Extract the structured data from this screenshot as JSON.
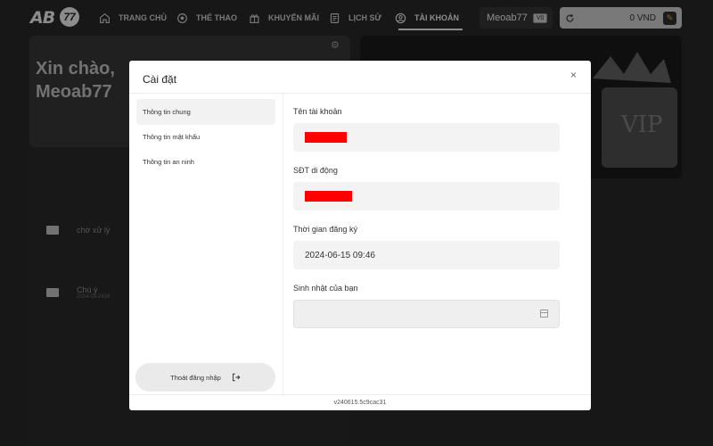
{
  "brand": {
    "logo_text": "AB",
    "logo_number": "77"
  },
  "nav": [
    {
      "id": "home",
      "label": "TRANG CHỦ",
      "icon": "home-icon"
    },
    {
      "id": "sports",
      "label": "THỂ THAO",
      "icon": "soccer-ball-icon"
    },
    {
      "id": "promo",
      "label": "KHUYẾN MÃI",
      "icon": "gift-icon"
    },
    {
      "id": "history",
      "label": "LỊCH SỬ",
      "icon": "document-icon"
    },
    {
      "id": "account",
      "label": "TÀI KHOẢN",
      "icon": "user-circle-icon",
      "active": true
    }
  ],
  "header": {
    "username": "Meoab77",
    "vip_badge": "V0",
    "balance": "0 VND"
  },
  "background": {
    "greeting_line1": "Xin chào,",
    "greeting_line2": "Meoab77",
    "notice_title": "Chú ý",
    "notice_date": "2024-03-2416",
    "status_text": "chờ xử lý"
  },
  "modal": {
    "title": "Cài đặt",
    "close_symbol": "×",
    "sidebar": [
      {
        "label": "Thông tin chung",
        "active": true
      },
      {
        "label": "Thông tin mật khẩu",
        "active": false
      },
      {
        "label": "Thông tin an ninh",
        "active": false
      }
    ],
    "logout_label": "Thoát đăng nhập",
    "version": "v240615.5c9cac31",
    "fields": {
      "account_name_label": "Tên tài khoản",
      "phone_label": "SĐT di động",
      "register_time_label": "Thời gian đăng ký",
      "register_time_value": "2024-06-15 09:46",
      "birthday_label": "Sinh nhật của bạn",
      "birthday_value": ""
    }
  },
  "colors": {
    "redaction": "#ff0000",
    "modal_bg": "#ffffff",
    "overlay": "#000000"
  }
}
